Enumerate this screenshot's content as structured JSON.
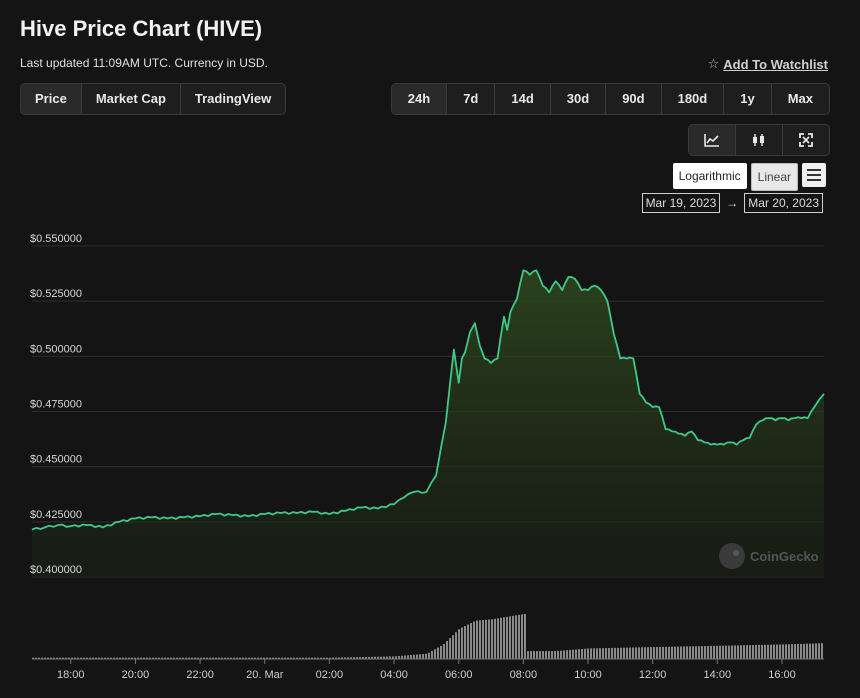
{
  "header": {
    "title": "Hive Price Chart (HIVE)",
    "subtitle": "Last updated 11:09AM UTC. Currency in USD.",
    "watchlist_label": "Add To Watchlist"
  },
  "chart_types": [
    "Price",
    "Market Cap",
    "TradingView"
  ],
  "ranges": [
    "24h",
    "7d",
    "14d",
    "30d",
    "90d",
    "180d",
    "1y",
    "Max"
  ],
  "view_icons": [
    "line-chart-icon",
    "candlestick-icon",
    "fullscreen-icon"
  ],
  "scale": {
    "log_label": "Logarithmic",
    "linear_label": "Linear"
  },
  "date_range": {
    "from": "Mar 19, 2023",
    "arrow": "→",
    "to": "Mar 20, 2023"
  },
  "watermark": "CoinGecko",
  "colors": {
    "line": "#3ec98a",
    "background": "#141414",
    "volume": "#8a8a8a"
  },
  "chart_data": {
    "type": "area",
    "title": "Hive Price Chart (HIVE)",
    "y_ticks": [
      "$0.550000",
      "$0.525000",
      "$0.500000",
      "$0.475000",
      "$0.450000",
      "$0.425000",
      "$0.400000"
    ],
    "ylim": [
      0.4,
      0.55
    ],
    "x_ticks": [
      "18:00",
      "20:00",
      "22:00",
      "20. Mar",
      "02:00",
      "04:00",
      "06:00",
      "08:00",
      "10:00",
      "12:00",
      "14:00",
      "16:00"
    ],
    "x_tick_hours": [
      18,
      20,
      22,
      24,
      26,
      28,
      30,
      32,
      34,
      36,
      38,
      40
    ],
    "xlim": [
      16.8,
      41.3
    ],
    "grid": true,
    "price_series": {
      "name": "Price",
      "x": [
        16.8,
        17.2,
        17.6,
        18.0,
        18.5,
        19.0,
        19.5,
        20.0,
        20.5,
        21.0,
        21.5,
        22.0,
        22.5,
        23.0,
        23.5,
        24.0,
        24.5,
        25.0,
        25.5,
        26.0,
        26.5,
        27.0,
        27.5,
        28.0,
        28.3,
        28.6,
        29.0,
        29.3,
        29.6,
        29.75,
        29.85,
        30.0,
        30.1,
        30.2,
        30.35,
        30.5,
        30.65,
        30.8,
        31.0,
        31.2,
        31.4,
        31.5,
        31.6,
        31.8,
        32.0,
        32.2,
        32.4,
        32.6,
        32.8,
        33.0,
        33.2,
        33.4,
        33.6,
        33.8,
        34.0,
        34.2,
        34.4,
        34.6,
        34.8,
        35.0,
        35.2,
        35.4,
        35.6,
        35.8,
        36.0,
        36.2,
        36.4,
        36.6,
        36.8,
        37.0,
        37.2,
        37.4,
        37.6,
        37.8,
        38.0,
        38.2,
        38.4,
        38.6,
        38.8,
        39.0,
        39.2,
        39.4,
        39.6,
        39.8,
        40.0,
        40.2,
        40.4,
        40.6,
        40.8,
        41.0,
        41.3
      ],
      "values": [
        0.4215,
        0.4225,
        0.4235,
        0.423,
        0.4235,
        0.4225,
        0.425,
        0.4265,
        0.427,
        0.4265,
        0.427,
        0.4275,
        0.4285,
        0.428,
        0.4275,
        0.4285,
        0.429,
        0.429,
        0.4295,
        0.4285,
        0.43,
        0.4315,
        0.431,
        0.433,
        0.436,
        0.4385,
        0.4385,
        0.446,
        0.47,
        0.49,
        0.503,
        0.488,
        0.499,
        0.502,
        0.511,
        0.515,
        0.505,
        0.499,
        0.497,
        0.499,
        0.518,
        0.512,
        0.52,
        0.526,
        0.539,
        0.537,
        0.539,
        0.532,
        0.529,
        0.534,
        0.53,
        0.536,
        0.535,
        0.53,
        0.53,
        0.532,
        0.53,
        0.525,
        0.51,
        0.499,
        0.499,
        0.499,
        0.483,
        0.479,
        0.477,
        0.477,
        0.467,
        0.466,
        0.465,
        0.464,
        0.466,
        0.462,
        0.461,
        0.46,
        0.46,
        0.46,
        0.461,
        0.46,
        0.462,
        0.463,
        0.469,
        0.471,
        0.472,
        0.471,
        0.472,
        0.471,
        0.472,
        0.472,
        0.472,
        0.477,
        0.483
      ]
    },
    "volume_series": {
      "name": "Volume",
      "x": [
        16.8,
        18,
        20,
        22,
        24,
        26,
        28,
        29,
        29.5,
        30,
        30.5,
        31,
        31.5,
        32,
        32.05,
        33,
        34,
        36,
        38,
        40,
        41.3
      ],
      "values": [
        1,
        1,
        1,
        1,
        1,
        1,
        2,
        4,
        11,
        23,
        29,
        30,
        32,
        34,
        6,
        6,
        8,
        9,
        10,
        11,
        12
      ]
    }
  }
}
